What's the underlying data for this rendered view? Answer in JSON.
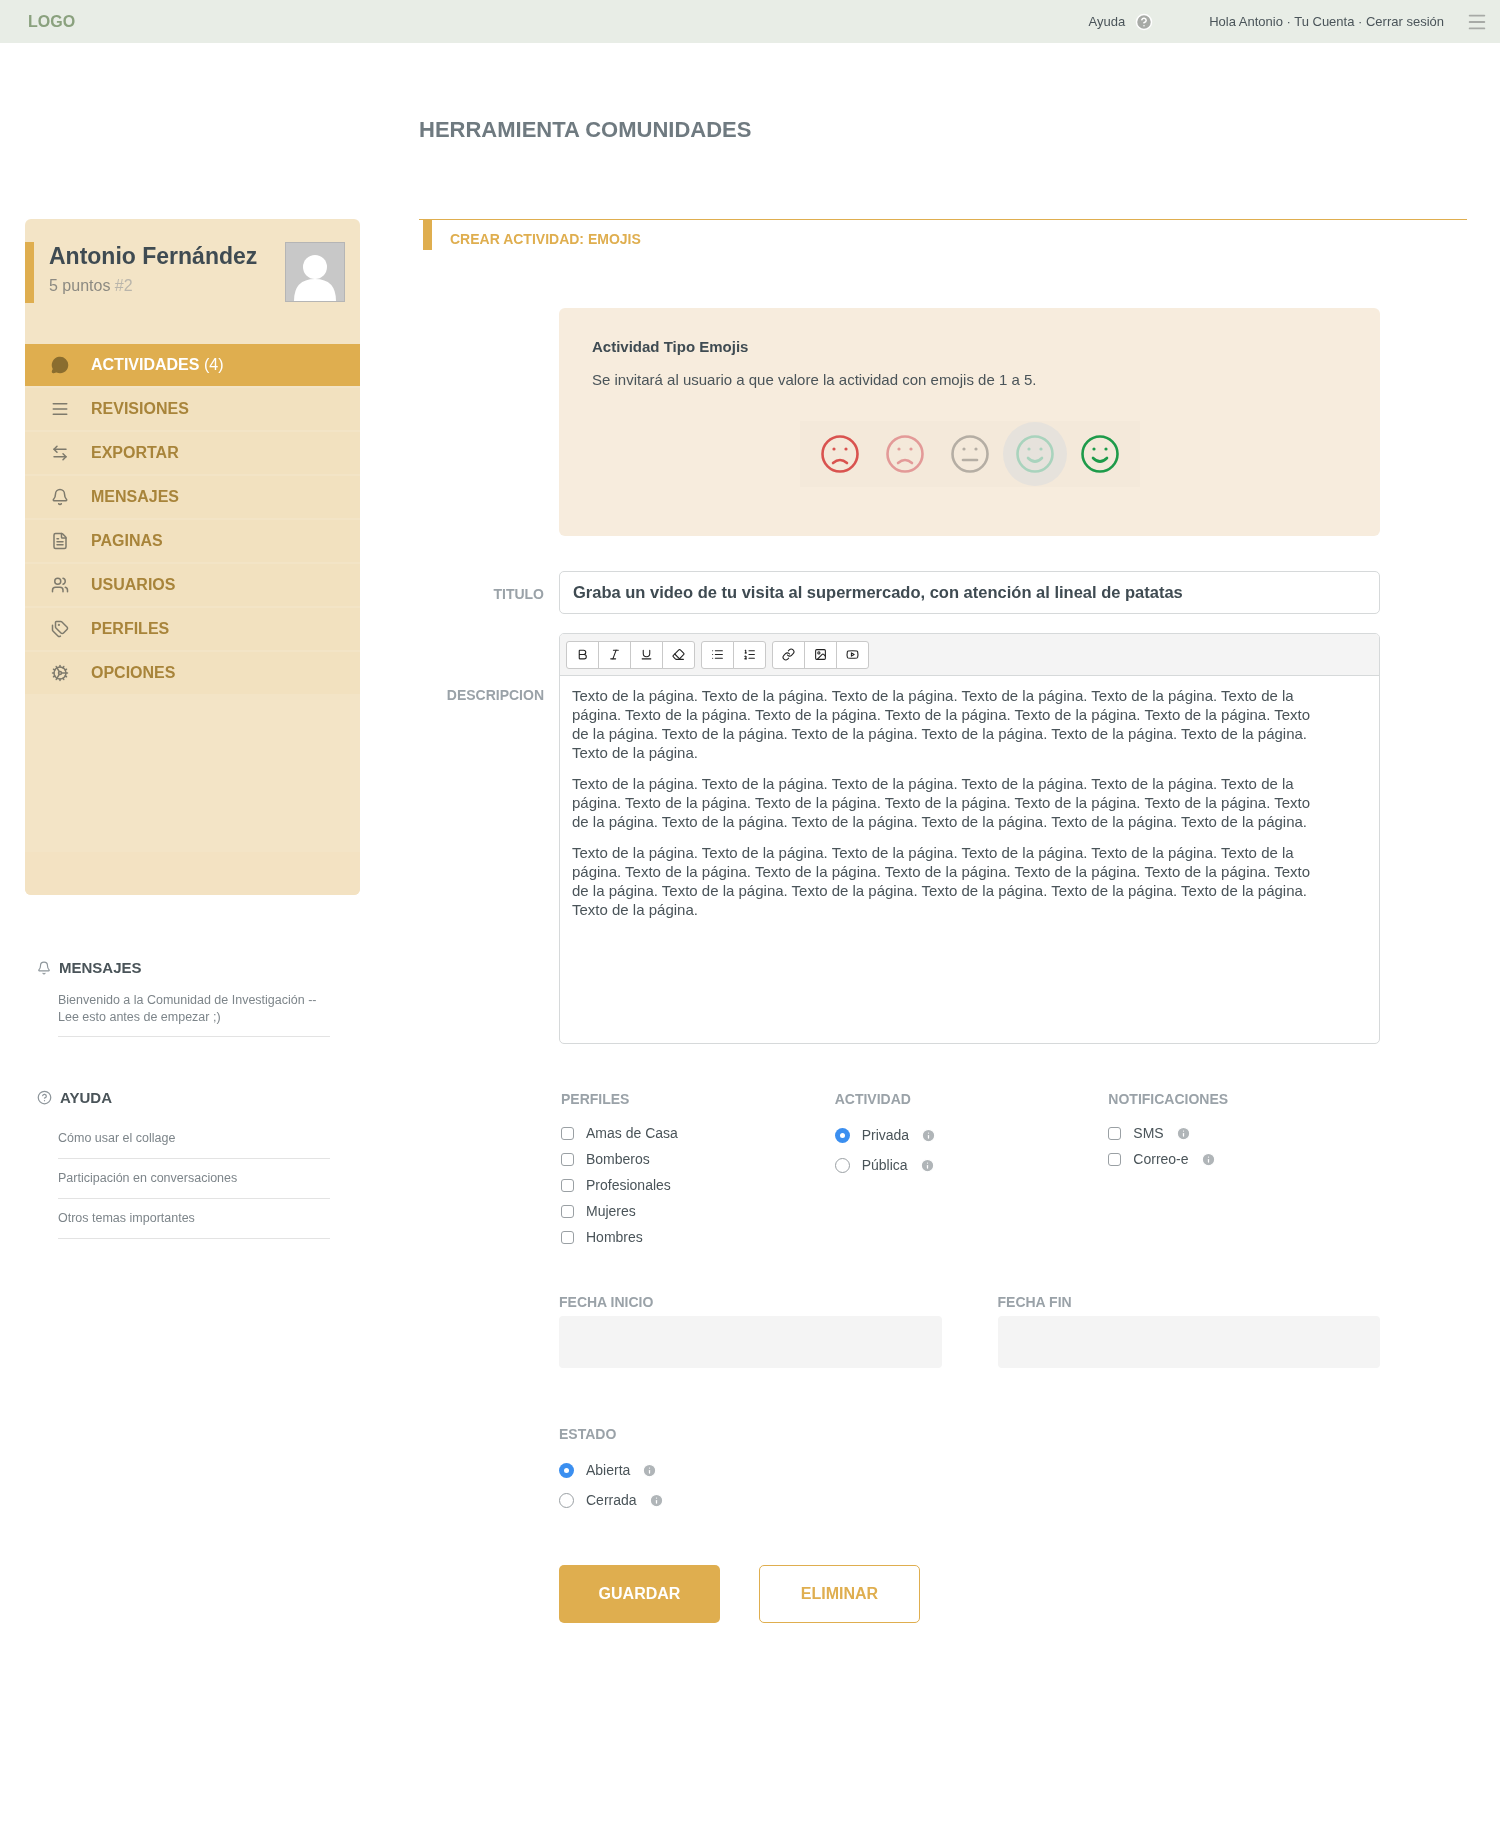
{
  "top_bar": {
    "logo": "LOGO",
    "help": "Ayuda",
    "account": "Hola Antonio · Tu Cuenta · Cerrar sesión"
  },
  "page_title": "HERRAMIENTA COMUNIDADES",
  "profile": {
    "name": "Antonio Fernández",
    "points": "5 puntos",
    "rank": "#2"
  },
  "sidebar": {
    "items": [
      {
        "label": "ACTIVIDADES",
        "count": "(4)",
        "selected": true
      },
      {
        "label": "REVISIONES",
        "selected": false
      },
      {
        "label": "EXPORTAR",
        "selected": false
      },
      {
        "label": "MENSAJES",
        "selected": false
      },
      {
        "label": "PAGINAS",
        "selected": false
      },
      {
        "label": "USUARIOS",
        "selected": false
      },
      {
        "label": "PERFILES",
        "selected": false
      },
      {
        "label": "OPCIONES",
        "selected": false
      }
    ]
  },
  "messages": {
    "title": "MENSAJES",
    "items": [
      "Bienvenido a la Comunidad de Investigación -- Lee esto antes de empezar ;)"
    ]
  },
  "help": {
    "title": "AYUDA",
    "items": [
      "Cómo usar el collage",
      "Participación en conversaciones",
      "Otros temas importantes"
    ]
  },
  "section_title": "CREAR ACTIVIDAD: EMOJIS",
  "info_box": {
    "title": "Actividad Tipo Emojis",
    "text": "Se invitará al usuario a que valore la actividad con emojis de 1 a 5.",
    "emojis": [
      {
        "kind": "sad",
        "color": "#d9534f",
        "selected": false
      },
      {
        "kind": "sad",
        "color": "#e39a98",
        "selected": false
      },
      {
        "kind": "neutral",
        "color": "#b5aea4",
        "selected": false
      },
      {
        "kind": "happy",
        "color": "#a9d3bd",
        "selected": true
      },
      {
        "kind": "happy",
        "color": "#1e9b4a",
        "selected": false
      }
    ]
  },
  "title_field": {
    "label": "TITULO",
    "value": "Graba un video de tu visita al supermercado, con atención al lineal de patatas"
  },
  "description": {
    "label": "DESCRIPCION",
    "paragraphs": [
      "Texto de la página. Texto de la página. Texto de la página. Texto de la página. Texto de la página. Texto de la página. Texto de la página. Texto de la página. Texto de la página. Texto de la página. Texto de la página. Texto de la página. Texto de la página. Texto de la página. Texto de la página. Texto de la página. Texto de la página. Texto de la página.",
      "Texto de la página. Texto de la página. Texto de la página. Texto de la página. Texto de la página. Texto de la página. Texto de la página. Texto de la página. Texto de la página. Texto de la página. Texto de la página. Texto de la página. Texto de la página. Texto de la página. Texto de la página. Texto de la página. Texto de la página.",
      "Texto de la página. Texto de la página. Texto de la página. Texto de la página. Texto de la página. Texto de la página. Texto de la página. Texto de la página. Texto de la página. Texto de la página. Texto de la página. Texto de la página. Texto de la página. Texto de la página. Texto de la página. Texto de la página. Texto de la página. Texto de la página."
    ]
  },
  "perfiles": {
    "title": "PERFILES",
    "options": [
      {
        "label": "Amas de Casa",
        "checked": false
      },
      {
        "label": "Bomberos",
        "checked": false
      },
      {
        "label": "Profesionales",
        "checked": false
      },
      {
        "label": "Mujeres",
        "checked": false
      },
      {
        "label": "Hombres",
        "checked": false
      }
    ]
  },
  "actividad": {
    "title": "ACTIVIDAD",
    "options": [
      {
        "label": "Privada",
        "selected": true
      },
      {
        "label": "Pública",
        "selected": false
      }
    ]
  },
  "notificaciones": {
    "title": "NOTIFICACIONES",
    "options": [
      {
        "label": "SMS",
        "checked": false
      },
      {
        "label": "Correo-e",
        "checked": false
      }
    ]
  },
  "dates": [
    {
      "label": "FECHA INICIO"
    },
    {
      "label": "FECHA FIN"
    }
  ],
  "estado": {
    "title": "ESTADO",
    "options": [
      {
        "label": "Abierta",
        "selected": true
      },
      {
        "label": "Cerrada",
        "selected": false
      }
    ]
  },
  "buttons": [
    {
      "label": "GUARDAR",
      "kind": "primary"
    },
    {
      "label": "ELIMINAR",
      "kind": "secondary"
    }
  ]
}
